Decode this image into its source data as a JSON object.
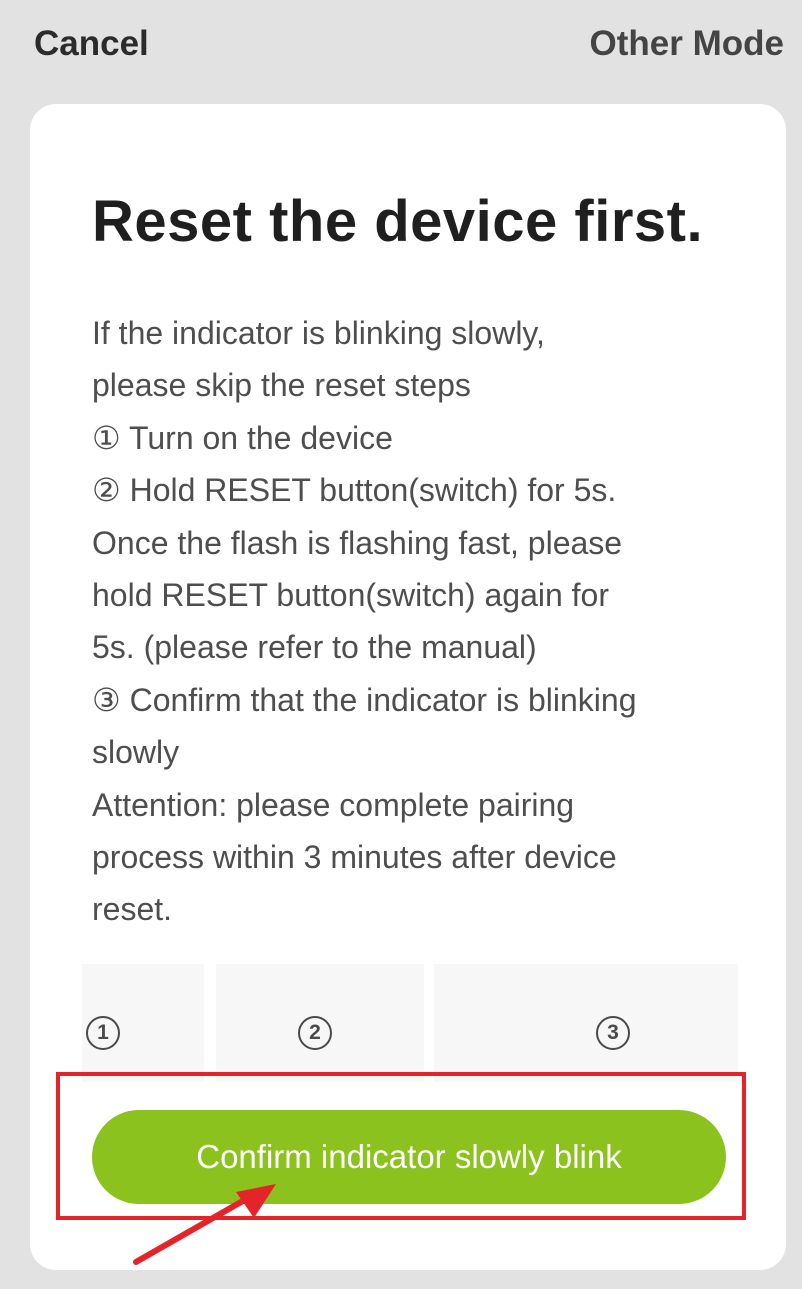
{
  "header": {
    "cancel_label": "Cancel",
    "other_mode_label": "Other Mode"
  },
  "card": {
    "title": "Reset the device first.",
    "instructions": [
      "If the indicator is blinking slowly,",
      "please skip the reset steps",
      "① Turn on the device",
      "② Hold RESET button(switch) for 5s.",
      "Once the flash is flashing fast, please",
      "hold RESET button(switch) again for",
      "5s. (please refer to the manual)",
      "③ Confirm that the indicator is blinking",
      "slowly",
      "Attention: please complete pairing",
      "process within 3 minutes after device",
      "reset."
    ],
    "steps": [
      "1",
      "2",
      "3"
    ],
    "confirm_label": "Confirm indicator slowly blink"
  },
  "colors": {
    "accent_green": "#8cc21d",
    "highlight_red": "#e5242a",
    "background": "#e2e2e2"
  },
  "icons": {
    "annotation": "red-arrow-icon"
  }
}
